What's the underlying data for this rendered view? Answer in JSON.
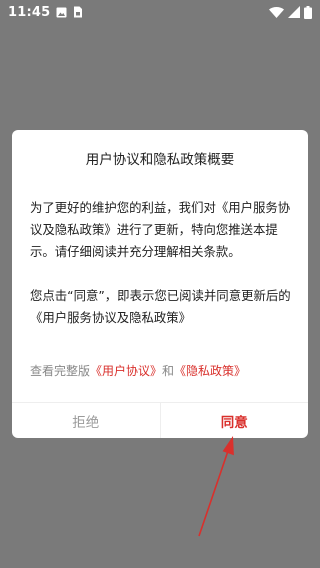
{
  "status_bar": {
    "time": "11:45"
  },
  "dialog": {
    "title": "用户协议和隐私政策概要",
    "paragraph1": "为了更好的维护您的利益，我们对《用户服务协议及隐私政策》进行了更新，特向您推送本提示。请仔细阅读并充分理解相关条款。",
    "paragraph2": "您点击“同意”，即表示您已阅读并同意更新后的 《用户服务协议及隐私政策》",
    "links": {
      "prefix": "查看完整版",
      "user_agreement": "《用户协议》",
      "and": "和",
      "privacy_policy": "《隐私政策》"
    },
    "buttons": {
      "reject": "拒绝",
      "agree": "同意"
    }
  },
  "colors": {
    "accent": "#d9302c",
    "overlay": "#7a7a7a",
    "muted": "#9a9a9a"
  },
  "icons": [
    "image-icon",
    "sim-card-icon",
    "wifi-icon",
    "signal-icon",
    "battery-icon",
    "annotation-arrow"
  ]
}
